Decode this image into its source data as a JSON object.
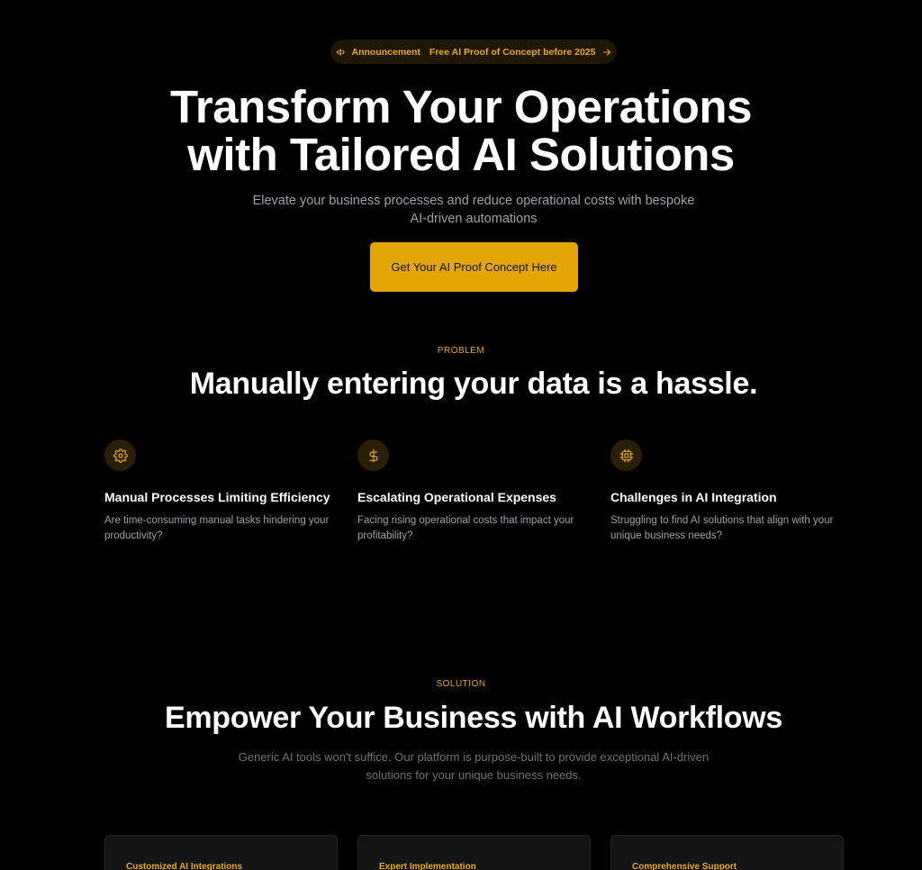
{
  "announcement": {
    "label": "Announcement",
    "text": "Free AI Proof of Concept before 2025"
  },
  "hero": {
    "title_line1": "Transform Your Operations",
    "title_line2": "with Tailored AI Solutions",
    "subtitle_line1": "Elevate your business processes and reduce operational costs with bespoke",
    "subtitle_line2": "AI-driven automations",
    "cta_label": "Get Your AI Proof Concept Here"
  },
  "problem": {
    "eyebrow": "PROBLEM",
    "title": "Manually entering your data is a hassle.",
    "items": [
      {
        "icon": "gear-icon",
        "title": "Manual Processes Limiting Efficiency",
        "text": "Are time-consuming manual tasks hindering your productivity?"
      },
      {
        "icon": "dollar-icon",
        "title": "Escalating Operational Expenses",
        "text": "Facing rising operational costs that impact your profitability?"
      },
      {
        "icon": "chip-icon",
        "title": "Challenges in AI Integration",
        "text": "Struggling to find AI solutions that align with your unique business needs?"
      }
    ]
  },
  "solution": {
    "eyebrow": "SOLUTION",
    "title": "Empower Your Business with AI Workflows",
    "subtitle_line1": "Generic AI tools won't suffice. Our platform is purpose-built to provide exceptional AI-driven",
    "subtitle_line2": "solutions for your unique business needs.",
    "cards": [
      {
        "title": "Customized AI Integrations"
      },
      {
        "title": "Expert Implementation"
      },
      {
        "title": "Comprehensive Support"
      }
    ]
  },
  "colors": {
    "background": "#000000",
    "accent": "#eaaa08",
    "cta_background": "#e3a604",
    "muted_text": "#a1a1aa"
  }
}
